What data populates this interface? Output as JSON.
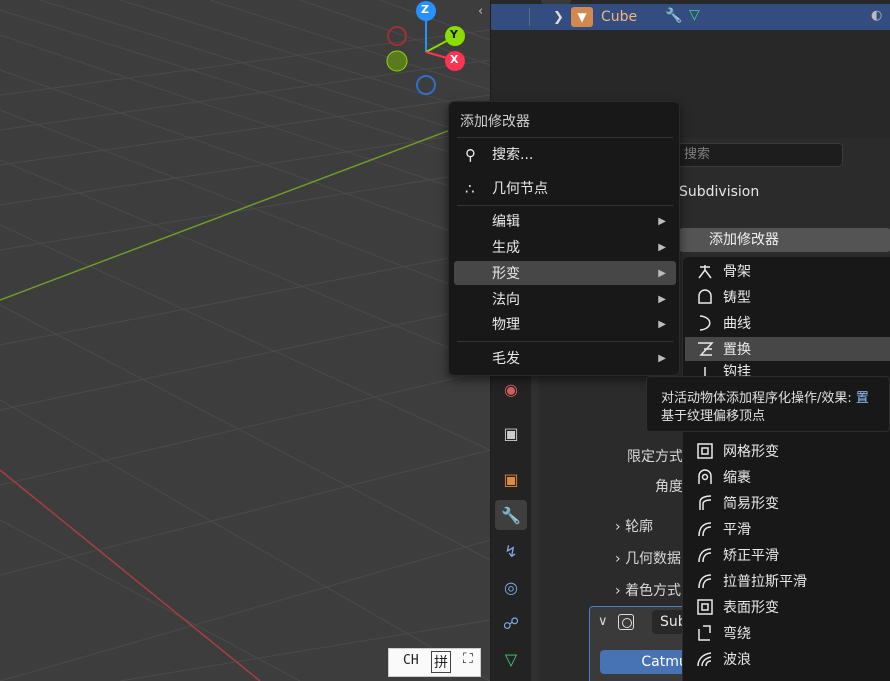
{
  "viewport": {
    "gizmo": {
      "z": "Z",
      "y": "Y",
      "x": "X"
    }
  },
  "outliner": {
    "object_name": "Cube"
  },
  "properties": {
    "search_placeholder": "搜索",
    "object_name": "Subdivision",
    "add_modifier_label": "添加修改器",
    "limit_method_label": "限定方式",
    "angle_label": "角度",
    "sections": [
      "轮廓",
      "几何数据",
      "着色方式"
    ],
    "modifier": {
      "name": "Subdivision",
      "method": "Catmull-Clar"
    }
  },
  "menu": {
    "title": "添加修改器",
    "search": "搜索...",
    "geometry_nodes": "几何节点",
    "items": [
      "编辑",
      "生成",
      "形变",
      "法向",
      "物理",
      "毛发"
    ],
    "highlighted": "形变"
  },
  "deform_menu": {
    "header": "添加修改器",
    "items": [
      "骨架",
      "铸型",
      "曲线",
      "置换",
      "钩挂",
      "网格形变",
      "缩裹",
      "简易形变",
      "平滑",
      "矫正平滑",
      "拉普拉斯平滑",
      "表面形变",
      "弯绕",
      "波浪"
    ],
    "highlighted": "置换"
  },
  "tooltip": {
    "line1": "对活动物体添加程序化操作/效果: ",
    "line1_highlight": "置",
    "line2": "基于纹理偏移顶点"
  },
  "ime": {
    "mode": "CH",
    "pinyin": "拼"
  },
  "colors": {
    "accent_blue": "#4772b3",
    "outliner_select": "#334d80",
    "axis_x": "#ff3352",
    "axis_y": "#8bdc00",
    "axis_z": "#2890ff"
  }
}
